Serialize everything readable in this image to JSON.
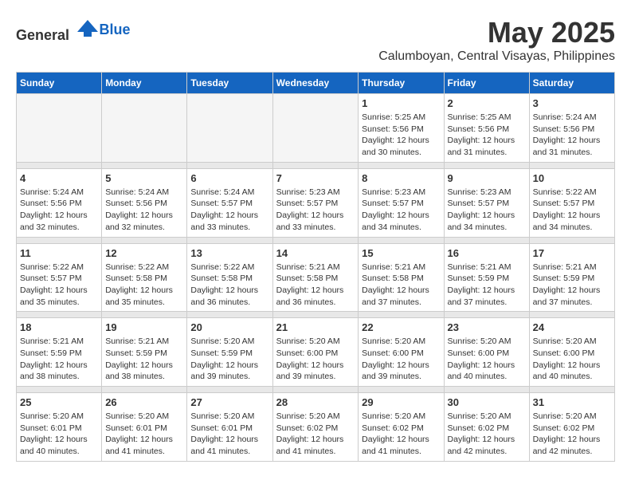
{
  "header": {
    "logo_general": "General",
    "logo_blue": "Blue",
    "title": "May 2025",
    "subtitle": "Calumboyan, Central Visayas, Philippines"
  },
  "calendar": {
    "days_of_week": [
      "Sunday",
      "Monday",
      "Tuesday",
      "Wednesday",
      "Thursday",
      "Friday",
      "Saturday"
    ],
    "weeks": [
      {
        "days": [
          {
            "num": "",
            "empty": true
          },
          {
            "num": "",
            "empty": true
          },
          {
            "num": "",
            "empty": true
          },
          {
            "num": "",
            "empty": true
          },
          {
            "num": "1",
            "sunrise": "5:25 AM",
            "sunset": "5:56 PM",
            "daylight": "12 hours and 30 minutes."
          },
          {
            "num": "2",
            "sunrise": "5:25 AM",
            "sunset": "5:56 PM",
            "daylight": "12 hours and 31 minutes."
          },
          {
            "num": "3",
            "sunrise": "5:24 AM",
            "sunset": "5:56 PM",
            "daylight": "12 hours and 31 minutes."
          }
        ]
      },
      {
        "days": [
          {
            "num": "4",
            "sunrise": "5:24 AM",
            "sunset": "5:56 PM",
            "daylight": "12 hours and 32 minutes."
          },
          {
            "num": "5",
            "sunrise": "5:24 AM",
            "sunset": "5:56 PM",
            "daylight": "12 hours and 32 minutes."
          },
          {
            "num": "6",
            "sunrise": "5:24 AM",
            "sunset": "5:57 PM",
            "daylight": "12 hours and 33 minutes."
          },
          {
            "num": "7",
            "sunrise": "5:23 AM",
            "sunset": "5:57 PM",
            "daylight": "12 hours and 33 minutes."
          },
          {
            "num": "8",
            "sunrise": "5:23 AM",
            "sunset": "5:57 PM",
            "daylight": "12 hours and 34 minutes."
          },
          {
            "num": "9",
            "sunrise": "5:23 AM",
            "sunset": "5:57 PM",
            "daylight": "12 hours and 34 minutes."
          },
          {
            "num": "10",
            "sunrise": "5:22 AM",
            "sunset": "5:57 PM",
            "daylight": "12 hours and 34 minutes."
          }
        ]
      },
      {
        "days": [
          {
            "num": "11",
            "sunrise": "5:22 AM",
            "sunset": "5:57 PM",
            "daylight": "12 hours and 35 minutes."
          },
          {
            "num": "12",
            "sunrise": "5:22 AM",
            "sunset": "5:58 PM",
            "daylight": "12 hours and 35 minutes."
          },
          {
            "num": "13",
            "sunrise": "5:22 AM",
            "sunset": "5:58 PM",
            "daylight": "12 hours and 36 minutes."
          },
          {
            "num": "14",
            "sunrise": "5:21 AM",
            "sunset": "5:58 PM",
            "daylight": "12 hours and 36 minutes."
          },
          {
            "num": "15",
            "sunrise": "5:21 AM",
            "sunset": "5:58 PM",
            "daylight": "12 hours and 37 minutes."
          },
          {
            "num": "16",
            "sunrise": "5:21 AM",
            "sunset": "5:59 PM",
            "daylight": "12 hours and 37 minutes."
          },
          {
            "num": "17",
            "sunrise": "5:21 AM",
            "sunset": "5:59 PM",
            "daylight": "12 hours and 37 minutes."
          }
        ]
      },
      {
        "days": [
          {
            "num": "18",
            "sunrise": "5:21 AM",
            "sunset": "5:59 PM",
            "daylight": "12 hours and 38 minutes."
          },
          {
            "num": "19",
            "sunrise": "5:21 AM",
            "sunset": "5:59 PM",
            "daylight": "12 hours and 38 minutes."
          },
          {
            "num": "20",
            "sunrise": "5:20 AM",
            "sunset": "5:59 PM",
            "daylight": "12 hours and 39 minutes."
          },
          {
            "num": "21",
            "sunrise": "5:20 AM",
            "sunset": "6:00 PM",
            "daylight": "12 hours and 39 minutes."
          },
          {
            "num": "22",
            "sunrise": "5:20 AM",
            "sunset": "6:00 PM",
            "daylight": "12 hours and 39 minutes."
          },
          {
            "num": "23",
            "sunrise": "5:20 AM",
            "sunset": "6:00 PM",
            "daylight": "12 hours and 40 minutes."
          },
          {
            "num": "24",
            "sunrise": "5:20 AM",
            "sunset": "6:00 PM",
            "daylight": "12 hours and 40 minutes."
          }
        ]
      },
      {
        "days": [
          {
            "num": "25",
            "sunrise": "5:20 AM",
            "sunset": "6:01 PM",
            "daylight": "12 hours and 40 minutes."
          },
          {
            "num": "26",
            "sunrise": "5:20 AM",
            "sunset": "6:01 PM",
            "daylight": "12 hours and 41 minutes."
          },
          {
            "num": "27",
            "sunrise": "5:20 AM",
            "sunset": "6:01 PM",
            "daylight": "12 hours and 41 minutes."
          },
          {
            "num": "28",
            "sunrise": "5:20 AM",
            "sunset": "6:02 PM",
            "daylight": "12 hours and 41 minutes."
          },
          {
            "num": "29",
            "sunrise": "5:20 AM",
            "sunset": "6:02 PM",
            "daylight": "12 hours and 41 minutes."
          },
          {
            "num": "30",
            "sunrise": "5:20 AM",
            "sunset": "6:02 PM",
            "daylight": "12 hours and 42 minutes."
          },
          {
            "num": "31",
            "sunrise": "5:20 AM",
            "sunset": "6:02 PM",
            "daylight": "12 hours and 42 minutes."
          }
        ]
      }
    ]
  }
}
